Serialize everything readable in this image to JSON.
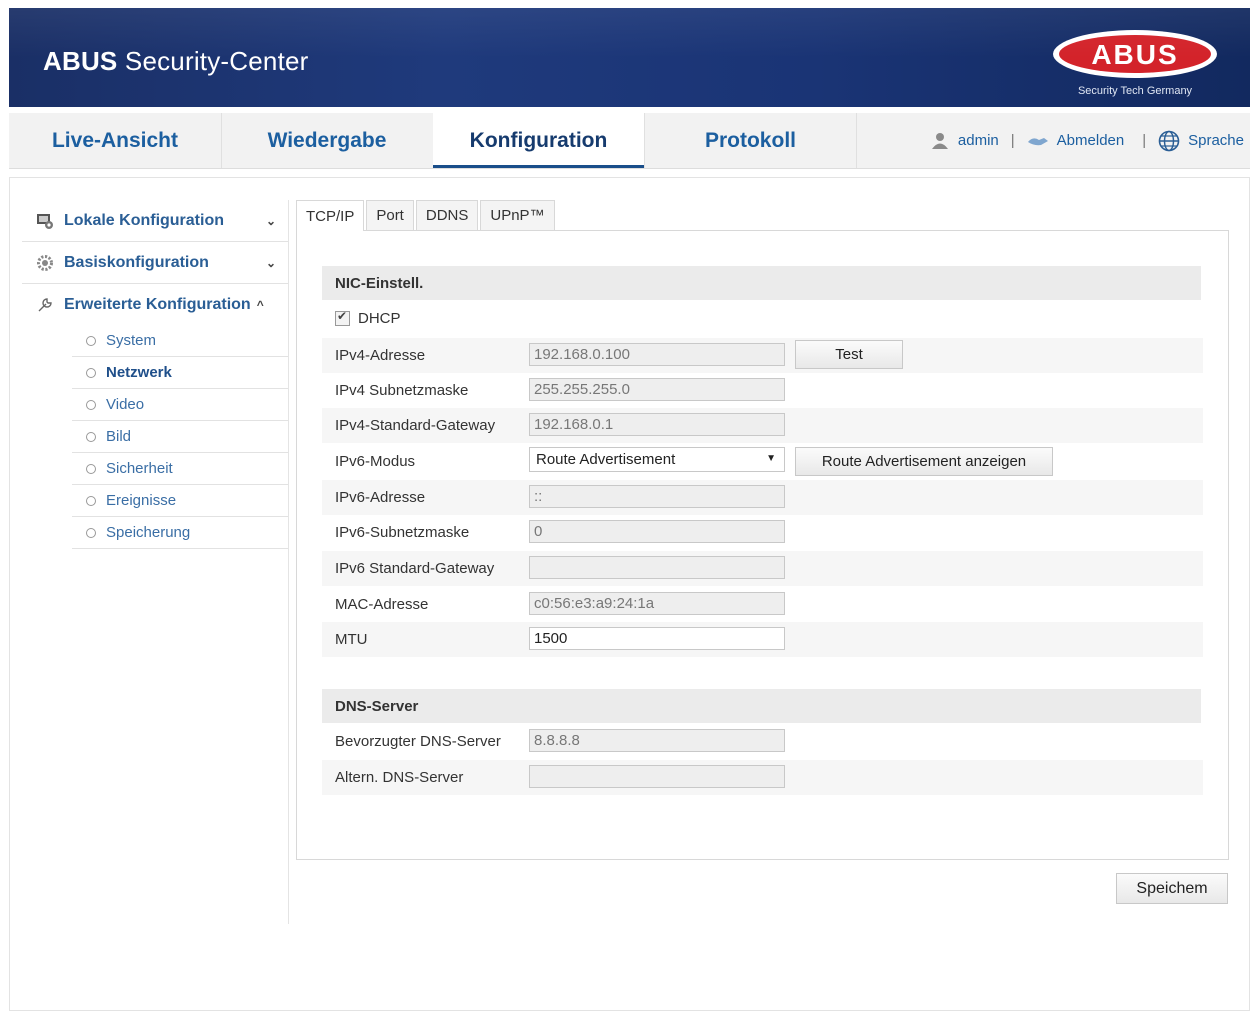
{
  "header": {
    "app_title_bold": "ABUS",
    "app_title_rest": " Security-Center",
    "logo_text": "ABUS",
    "logo_tagline": "Security Tech Germany"
  },
  "nav": {
    "tabs": [
      {
        "label": "Live-Ansicht"
      },
      {
        "label": "Wiedergabe"
      },
      {
        "label": "Konfiguration"
      },
      {
        "label": "Protokoll"
      }
    ],
    "user": "admin",
    "logout": "Abmelden",
    "language": "Sprache",
    "separator": "|"
  },
  "sidebar": {
    "sections": [
      {
        "label": "Lokale Konfiguration",
        "chevron": "⌄"
      },
      {
        "label": "Basiskonfiguration",
        "chevron": "⌄"
      },
      {
        "label": "Erweiterte Konfiguration",
        "chevron": "^"
      }
    ],
    "subitems": [
      {
        "label": "System"
      },
      {
        "label": "Netzwerk"
      },
      {
        "label": "Video"
      },
      {
        "label": "Bild"
      },
      {
        "label": "Sicherheit"
      },
      {
        "label": "Ereignisse"
      },
      {
        "label": "Speicherung"
      }
    ]
  },
  "tabs": [
    {
      "label": "TCP/IP"
    },
    {
      "label": "Port"
    },
    {
      "label": "DDNS"
    },
    {
      "label": "UPnP™"
    }
  ],
  "nic": {
    "title": "NIC-Einstell.",
    "dhcp_label": "DHCP",
    "ipv4_address": {
      "label": "IPv4-Adresse",
      "value": "192.168.0.100"
    },
    "test_button": "Test",
    "ipv4_subnet": {
      "label": "IPv4 Subnetzmaske",
      "value": "255.255.255.0"
    },
    "ipv4_gateway": {
      "label": "IPv4-Standard-Gateway",
      "value": "192.168.0.1"
    },
    "ipv6_mode": {
      "label": "IPv6-Modus",
      "value": "Route Advertisement"
    },
    "route_button": "Route Advertisement anzeigen",
    "ipv6_address": {
      "label": "IPv6-Adresse",
      "value": "::"
    },
    "ipv6_subnet": {
      "label": "IPv6-Subnetzmaske",
      "value": "0"
    },
    "ipv6_gateway": {
      "label": "IPv6 Standard-Gateway",
      "value": ""
    },
    "mac": {
      "label": "MAC-Adresse",
      "value": "c0:56:e3:a9:24:1a"
    },
    "mtu": {
      "label": "MTU",
      "value": "1500"
    }
  },
  "dns": {
    "title": "DNS-Server",
    "preferred": {
      "label": "Bevorzugter DNS-Server",
      "value": "8.8.8.8"
    },
    "alternate": {
      "label": "Altern. DNS-Server",
      "value": ""
    }
  },
  "save_button": "Speichem"
}
